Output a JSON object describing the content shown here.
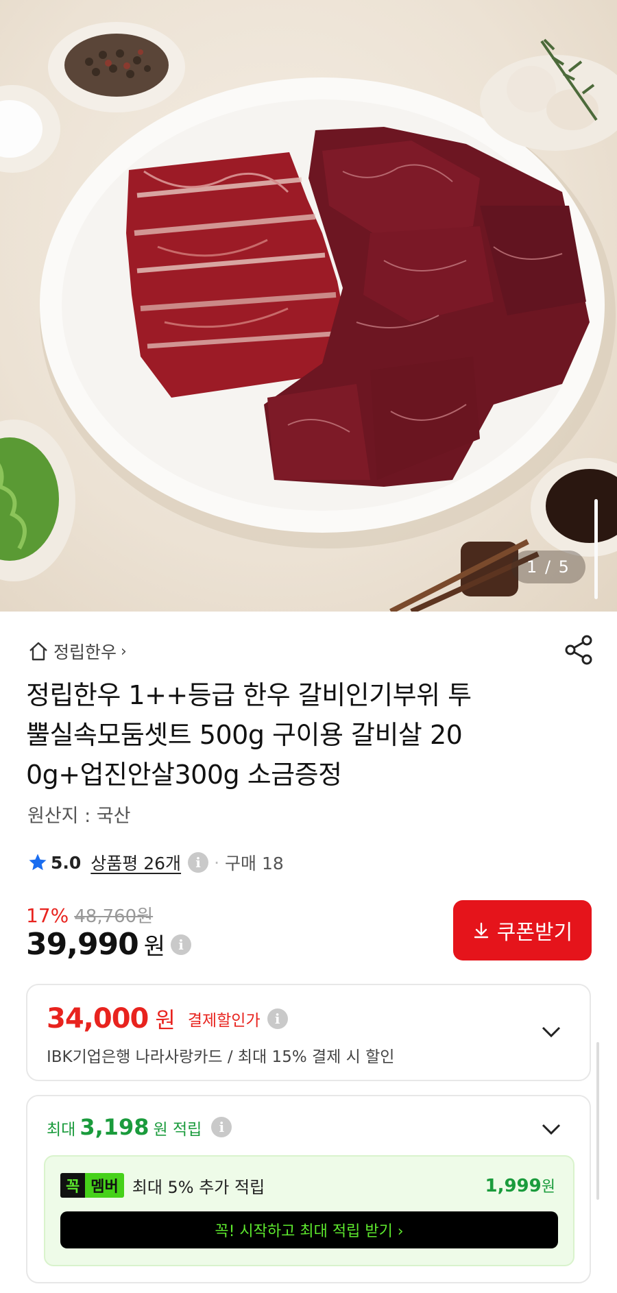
{
  "gallery": {
    "page_indicator": "1 / 5"
  },
  "store": {
    "name": "정립한우",
    "chevron": "›"
  },
  "product": {
    "title_lines": [
      "정립한우 1++등급 한우 갈비인기부위 투",
      "뿔실속모둠셋트 500g 구이용 갈비살 20",
      "0g+업진안살300g 소금증정"
    ],
    "origin": "원산지 : 국산"
  },
  "rating": {
    "score": "5.0",
    "reviews_label": "상품평 26개",
    "purchases": "구매 18"
  },
  "pricing": {
    "discount_pct": "17%",
    "original_price": "48,760원",
    "price": "39,990",
    "currency": "원",
    "coupon_button": "쿠폰받기"
  },
  "payment_discount": {
    "amount": "34,000",
    "currency": "원",
    "label": "결제할인가",
    "detail": "IBK기업은행 나라사랑카드 / 최대 15% 결제 시 할인"
  },
  "points": {
    "prefix": "최대",
    "amount": "3,198",
    "unit": "원 적립",
    "member_badge_left": "꼭",
    "member_badge_right": "멤버",
    "member_text": "최대 5% 추가 적립",
    "member_amount": "1,999",
    "member_unit": "원",
    "start_button": "꼭! 시작하고 최대 적립 받기  ›"
  },
  "colors": {
    "accent_red": "#e5141b",
    "points_green": "#1a9b3c",
    "member_green": "#46d11a"
  }
}
